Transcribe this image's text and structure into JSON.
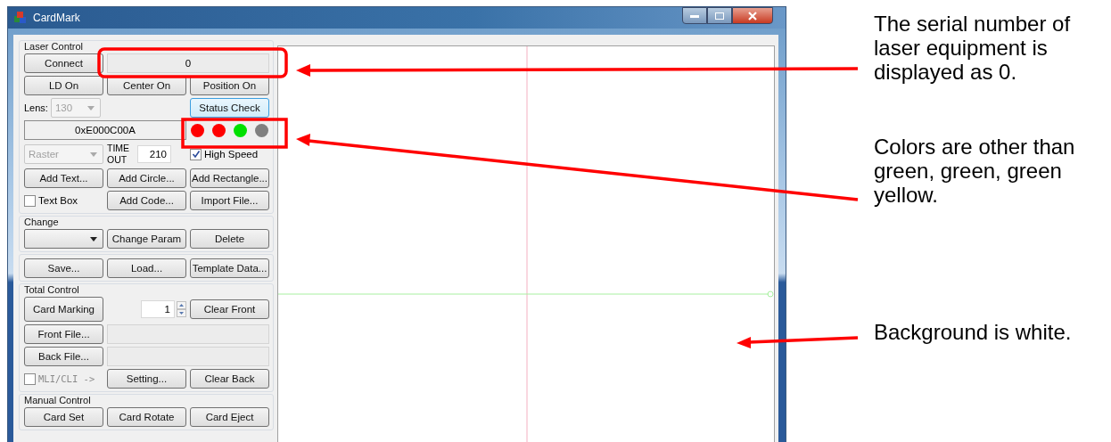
{
  "window": {
    "title": "CardMark"
  },
  "laser_control": {
    "title": "Laser Control",
    "connect_button": "Connect",
    "serial_number": "0",
    "buttons": [
      "LD On",
      "Center On",
      "Position On"
    ],
    "lens": {
      "label": "Lens:",
      "value": "130",
      "disabled": true
    },
    "status_check_button": "Status Check",
    "status_code": "0xE000C00A",
    "status_lights": [
      {
        "color": "#ff0000"
      },
      {
        "color": "#ff0000"
      },
      {
        "color": "#00e000"
      },
      {
        "color": "#808080"
      }
    ],
    "mode": {
      "value": "Raster",
      "disabled": true
    },
    "timeout": {
      "label": "TIME OUT",
      "value": "210"
    },
    "high_speed": {
      "label": "High Speed",
      "checked": true
    },
    "add_buttons": [
      "Add Text...",
      "Add Circle...",
      "Add Rectangle..."
    ],
    "text_box": {
      "label": "Text Box",
      "checked": false
    },
    "add_code_button": "Add Code...",
    "import_button": "Import File..."
  },
  "change": {
    "title": "Change",
    "buttons": [
      "Change Param",
      "Delete"
    ]
  },
  "file_buttons": [
    "Save...",
    "Load...",
    "Template Data..."
  ],
  "total_control": {
    "title": "Total Control",
    "card_marking_button": "Card Marking",
    "count": "1",
    "clear_front_button": "Clear Front",
    "front_file_button": "Front File...",
    "back_file_button": "Back File...",
    "mli_cli": {
      "label": "MLI/CLI ->",
      "checked": false,
      "disabled": true
    },
    "setting_button": "Setting...",
    "clear_back_button": "Clear Back"
  },
  "manual_control": {
    "title": "Manual Control",
    "buttons": [
      "Card Set",
      "Card Rotate",
      "Card Eject"
    ]
  },
  "annotations": [
    {
      "text": "The serial number of laser equipment is displayed as 0."
    },
    {
      "text": "Colors are other than green, green, green yellow."
    },
    {
      "text": "Background is white."
    }
  ]
}
